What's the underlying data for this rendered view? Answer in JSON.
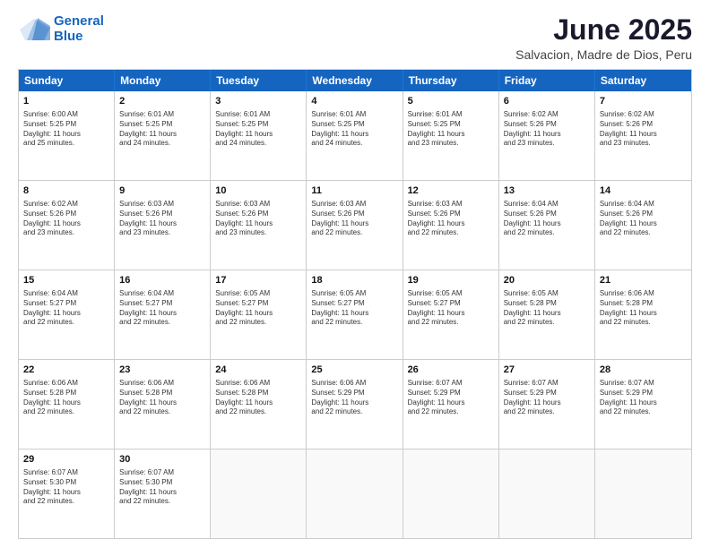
{
  "header": {
    "logo_line1": "General",
    "logo_line2": "Blue",
    "title": "June 2025",
    "subtitle": "Salvacion, Madre de Dios, Peru"
  },
  "weekdays": [
    "Sunday",
    "Monday",
    "Tuesday",
    "Wednesday",
    "Thursday",
    "Friday",
    "Saturday"
  ],
  "rows": [
    [
      {
        "day": "",
        "empty": true,
        "text": ""
      },
      {
        "day": "2",
        "text": "Sunrise: 6:01 AM\nSunset: 5:25 PM\nDaylight: 11 hours\nand 24 minutes."
      },
      {
        "day": "3",
        "text": "Sunrise: 6:01 AM\nSunset: 5:25 PM\nDaylight: 11 hours\nand 24 minutes."
      },
      {
        "day": "4",
        "text": "Sunrise: 6:01 AM\nSunset: 5:25 PM\nDaylight: 11 hours\nand 24 minutes."
      },
      {
        "day": "5",
        "text": "Sunrise: 6:01 AM\nSunset: 5:25 PM\nDaylight: 11 hours\nand 23 minutes."
      },
      {
        "day": "6",
        "text": "Sunrise: 6:02 AM\nSunset: 5:26 PM\nDaylight: 11 hours\nand 23 minutes."
      },
      {
        "day": "7",
        "text": "Sunrise: 6:02 AM\nSunset: 5:26 PM\nDaylight: 11 hours\nand 23 minutes."
      }
    ],
    [
      {
        "day": "1",
        "text": "Sunrise: 6:00 AM\nSunset: 5:25 PM\nDaylight: 11 hours\nand 25 minutes."
      },
      {
        "day": "",
        "empty": true,
        "text": ""
      },
      {
        "day": "",
        "empty": true,
        "text": ""
      },
      {
        "day": "",
        "empty": true,
        "text": ""
      },
      {
        "day": "",
        "empty": true,
        "text": ""
      },
      {
        "day": "",
        "empty": true,
        "text": ""
      },
      {
        "day": "",
        "empty": true,
        "text": ""
      }
    ],
    [
      {
        "day": "8",
        "text": "Sunrise: 6:02 AM\nSunset: 5:26 PM\nDaylight: 11 hours\nand 23 minutes."
      },
      {
        "day": "9",
        "text": "Sunrise: 6:03 AM\nSunset: 5:26 PM\nDaylight: 11 hours\nand 23 minutes."
      },
      {
        "day": "10",
        "text": "Sunrise: 6:03 AM\nSunset: 5:26 PM\nDaylight: 11 hours\nand 23 minutes."
      },
      {
        "day": "11",
        "text": "Sunrise: 6:03 AM\nSunset: 5:26 PM\nDaylight: 11 hours\nand 22 minutes."
      },
      {
        "day": "12",
        "text": "Sunrise: 6:03 AM\nSunset: 5:26 PM\nDaylight: 11 hours\nand 22 minutes."
      },
      {
        "day": "13",
        "text": "Sunrise: 6:04 AM\nSunset: 5:26 PM\nDaylight: 11 hours\nand 22 minutes."
      },
      {
        "day": "14",
        "text": "Sunrise: 6:04 AM\nSunset: 5:26 PM\nDaylight: 11 hours\nand 22 minutes."
      }
    ],
    [
      {
        "day": "15",
        "text": "Sunrise: 6:04 AM\nSunset: 5:27 PM\nDaylight: 11 hours\nand 22 minutes."
      },
      {
        "day": "16",
        "text": "Sunrise: 6:04 AM\nSunset: 5:27 PM\nDaylight: 11 hours\nand 22 minutes."
      },
      {
        "day": "17",
        "text": "Sunrise: 6:05 AM\nSunset: 5:27 PM\nDaylight: 11 hours\nand 22 minutes."
      },
      {
        "day": "18",
        "text": "Sunrise: 6:05 AM\nSunset: 5:27 PM\nDaylight: 11 hours\nand 22 minutes."
      },
      {
        "day": "19",
        "text": "Sunrise: 6:05 AM\nSunset: 5:27 PM\nDaylight: 11 hours\nand 22 minutes."
      },
      {
        "day": "20",
        "text": "Sunrise: 6:05 AM\nSunset: 5:28 PM\nDaylight: 11 hours\nand 22 minutes."
      },
      {
        "day": "21",
        "text": "Sunrise: 6:06 AM\nSunset: 5:28 PM\nDaylight: 11 hours\nand 22 minutes."
      }
    ],
    [
      {
        "day": "22",
        "text": "Sunrise: 6:06 AM\nSunset: 5:28 PM\nDaylight: 11 hours\nand 22 minutes."
      },
      {
        "day": "23",
        "text": "Sunrise: 6:06 AM\nSunset: 5:28 PM\nDaylight: 11 hours\nand 22 minutes."
      },
      {
        "day": "24",
        "text": "Sunrise: 6:06 AM\nSunset: 5:28 PM\nDaylight: 11 hours\nand 22 minutes."
      },
      {
        "day": "25",
        "text": "Sunrise: 6:06 AM\nSunset: 5:29 PM\nDaylight: 11 hours\nand 22 minutes."
      },
      {
        "day": "26",
        "text": "Sunrise: 6:07 AM\nSunset: 5:29 PM\nDaylight: 11 hours\nand 22 minutes."
      },
      {
        "day": "27",
        "text": "Sunrise: 6:07 AM\nSunset: 5:29 PM\nDaylight: 11 hours\nand 22 minutes."
      },
      {
        "day": "28",
        "text": "Sunrise: 6:07 AM\nSunset: 5:29 PM\nDaylight: 11 hours\nand 22 minutes."
      }
    ],
    [
      {
        "day": "29",
        "text": "Sunrise: 6:07 AM\nSunset: 5:30 PM\nDaylight: 11 hours\nand 22 minutes."
      },
      {
        "day": "30",
        "text": "Sunrise: 6:07 AM\nSunset: 5:30 PM\nDaylight: 11 hours\nand 22 minutes."
      },
      {
        "day": "",
        "empty": true,
        "text": ""
      },
      {
        "day": "",
        "empty": true,
        "text": ""
      },
      {
        "day": "",
        "empty": true,
        "text": ""
      },
      {
        "day": "",
        "empty": true,
        "text": ""
      },
      {
        "day": "",
        "empty": true,
        "text": ""
      }
    ]
  ]
}
